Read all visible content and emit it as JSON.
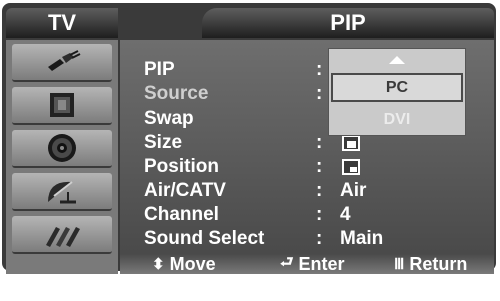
{
  "header": {
    "left_title": "TV",
    "title": "PIP"
  },
  "sidebar": {
    "items": [
      {
        "icon": "tv-input-plug-icon"
      },
      {
        "icon": "picture-icon"
      },
      {
        "icon": "speaker-icon"
      },
      {
        "icon": "satellite-dish-icon"
      },
      {
        "icon": "cables-icon"
      }
    ]
  },
  "menu": {
    "rows": [
      {
        "label": "PIP",
        "colon": ":",
        "value": ""
      },
      {
        "label": "Source",
        "colon": ":",
        "value": ""
      },
      {
        "label": "Swap",
        "colon": "",
        "value": ""
      },
      {
        "label": "Size",
        "colon": ":",
        "value": ""
      },
      {
        "label": "Position",
        "colon": ":",
        "value": ""
      },
      {
        "label": "Air/CATV",
        "colon": ":",
        "value": "Air"
      },
      {
        "label": "Channel",
        "colon": ":",
        "value": "4"
      },
      {
        "label": "Sound Select",
        "colon": ":",
        "value": "Main"
      }
    ]
  },
  "dropdown": {
    "options": [
      "PC",
      "DVI"
    ],
    "selected": "PC"
  },
  "footer": {
    "move": "Move",
    "enter": "Enter",
    "return": "Return"
  }
}
